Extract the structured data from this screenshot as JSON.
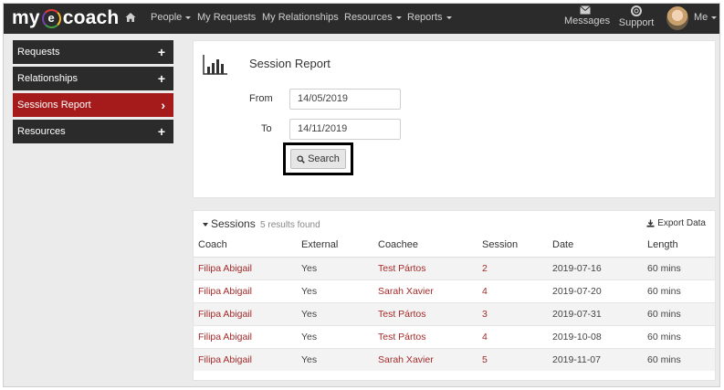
{
  "brand": {
    "prefix": "my",
    "ring_letter": "e",
    "suffix": "coach"
  },
  "nav": {
    "items": [
      {
        "label": "People",
        "dropdown": true
      },
      {
        "label": "My Requests",
        "dropdown": false
      },
      {
        "label": "My Relationships",
        "dropdown": false
      },
      {
        "label": "Resources",
        "dropdown": true
      },
      {
        "label": "Reports",
        "dropdown": true
      }
    ],
    "messages_label": "Messages",
    "support_label": "Support",
    "me_label": "Me"
  },
  "sidebar": {
    "items": [
      {
        "label": "Requests",
        "symbol": "+",
        "active": false
      },
      {
        "label": "Relationships",
        "symbol": "+",
        "active": false
      },
      {
        "label": "Sessions Report",
        "symbol": "›",
        "active": true
      },
      {
        "label": "Resources",
        "symbol": "+",
        "active": false
      }
    ]
  },
  "report": {
    "title": "Session Report",
    "from_label": "From",
    "from_value": "14/05/2019",
    "to_label": "To",
    "to_value": "14/11/2019",
    "search_label": "Search"
  },
  "sessions": {
    "title": "Sessions",
    "count_text": "5 results found",
    "export_label": "Export Data",
    "columns": [
      "Coach",
      "External",
      "Coachee",
      "Session",
      "Date",
      "Length"
    ],
    "rows": [
      {
        "coach": "Filipa Abigail",
        "external": "Yes",
        "coachee": "Test Pártos",
        "session": "2",
        "date": "2019-07-16",
        "length": "60 mins"
      },
      {
        "coach": "Filipa Abigail",
        "external": "Yes",
        "coachee": "Sarah Xavier",
        "session": "4",
        "date": "2019-07-20",
        "length": "60 mins"
      },
      {
        "coach": "Filipa Abigail",
        "external": "Yes",
        "coachee": "Test Pártos",
        "session": "3",
        "date": "2019-07-31",
        "length": "60 mins"
      },
      {
        "coach": "Filipa Abigail",
        "external": "Yes",
        "coachee": "Test Pártos",
        "session": "4",
        "date": "2019-10-08",
        "length": "60 mins"
      },
      {
        "coach": "Filipa Abigail",
        "external": "Yes",
        "coachee": "Sarah Xavier",
        "session": "5",
        "date": "2019-11-07",
        "length": "60 mins"
      }
    ]
  },
  "colors": {
    "navbar": "#2b2b2b",
    "active": "#a51b1b",
    "link": "#a52a2a",
    "background": "#ebebeb"
  },
  "icons": {
    "home": "home-icon",
    "messages": "envelope-icon",
    "support": "life-ring-icon",
    "chart": "bar-chart-icon",
    "search": "search-icon",
    "export": "download-icon"
  }
}
